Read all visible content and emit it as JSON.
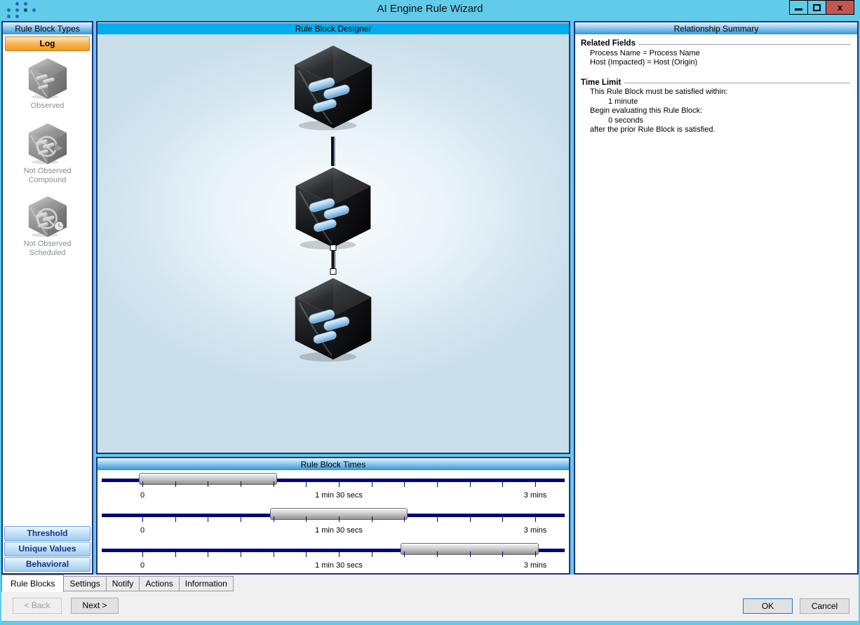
{
  "window": {
    "title": "AI Engine Rule Wizard"
  },
  "colors": {
    "titlebar": "#62cbe9",
    "close_button": "#c05750",
    "panel_border": "#25307c",
    "designer_header": "#00aeee",
    "log_button_orange": "#f7b24a",
    "category_button_text": "#16348c",
    "slider_track_navy": "#010282",
    "header_gradient_bottom": "#2f98dd"
  },
  "sidebar": {
    "header": "Rule Block Types",
    "log_button": "Log",
    "types": [
      {
        "label": "Observed"
      },
      {
        "label": "Not Observed Compound"
      },
      {
        "label": "Not Observed Scheduled"
      }
    ],
    "category_buttons": [
      "Threshold",
      "Unique Values",
      "Behavioral"
    ]
  },
  "designer": {
    "header": "Rule Block Designer",
    "blocks": [
      "rule-block-1",
      "rule-block-2",
      "rule-block-3"
    ],
    "connectors": [
      {
        "between": "block-1-and-2",
        "selected": false
      },
      {
        "between": "block-2-and-3",
        "selected": true
      }
    ]
  },
  "times": {
    "header": "Rule Block Times",
    "axis_labels": {
      "start": "0",
      "middle": "1 min 30 secs",
      "end": "3 mins"
    },
    "axis_range_minutes": 3,
    "sliders": [
      {
        "start_min": 0,
        "end_min": 1
      },
      {
        "start_min": 1,
        "end_min": 2
      },
      {
        "start_min": 2,
        "end_min": 3
      }
    ]
  },
  "summary": {
    "header": "Relationship Summary",
    "related_fields": {
      "title": "Related Fields",
      "items": [
        "Process Name = Process Name",
        "Host (Impacted) = Host (Origin)"
      ]
    },
    "time_limit": {
      "title": "Time Limit",
      "lines": [
        {
          "text": "This Rule Block must be satisfied within:",
          "indent": 1
        },
        {
          "text": "1 minute",
          "indent": 2
        },
        {
          "text": "Begin evaluating this Rule Block:",
          "indent": 1
        },
        {
          "text": "0 seconds",
          "indent": 2
        },
        {
          "text": "after the prior Rule Block is satisfied.",
          "indent": 1
        }
      ]
    }
  },
  "tabs": [
    {
      "label": "Rule Blocks",
      "active": true
    },
    {
      "label": "Settings",
      "active": false
    },
    {
      "label": "Notify",
      "active": false
    },
    {
      "label": "Actions",
      "active": false
    },
    {
      "label": "Information",
      "active": false
    }
  ],
  "footer": {
    "back": "< Back",
    "back_enabled": false,
    "next": "Next >",
    "ok": "OK",
    "cancel": "Cancel"
  }
}
